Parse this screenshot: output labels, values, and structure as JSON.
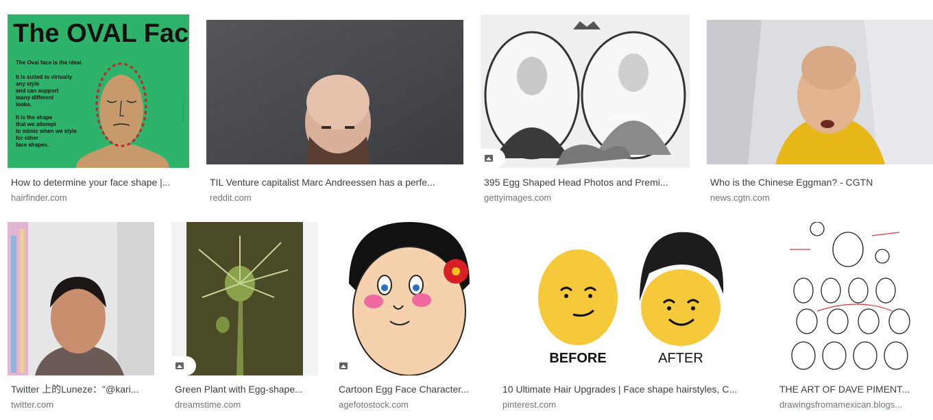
{
  "results": [
    {
      "title": "How to determine your face shape |...",
      "source": "hairfinder.com",
      "image_text": {
        "heading": "The OVAL Face",
        "lines": [
          "The Oval face is the ideal.",
          "It is suited to virtually",
          "any style",
          "and can support",
          "many different",
          "looks.",
          "It is the shape",
          "that we attempt",
          "to mimic when we style",
          "for other",
          "face shapes."
        ],
        "watermark": "www.hairfinder.com"
      }
    },
    {
      "title": "TIL Venture capitalist Marc Andreessen has a perfe...",
      "source": "reddit.com"
    },
    {
      "title": "395 Egg Shaped Head Photos and Premi...",
      "source": "gettyimages.com",
      "image_text": {
        "watermark": "gettyimages"
      }
    },
    {
      "title": "Who is the Chinese Eggman? - CGTN",
      "source": "news.cgtn.com"
    },
    {
      "title": "Twitter 上的Luneze：\"@kari...",
      "source": "twitter.com"
    },
    {
      "title": "Green Plant with Egg-shape...",
      "source": "dreamstime.com"
    },
    {
      "title": "Cartoon Egg Face Character...",
      "source": "agefotostock.com"
    },
    {
      "title": "10 Ultimate Hair Upgrades | Face shape hairstyles, C...",
      "source": "pinterest.com",
      "image_text": {
        "before": "BEFORE",
        "after": "AFTER"
      }
    },
    {
      "title": "THE ART OF DAVE PIMENT...",
      "source": "drawingsfromamexican.blogs..."
    }
  ],
  "colors": {
    "title": "#3c4043",
    "source": "#70757a",
    "placeholder": "#f1f3f4"
  }
}
